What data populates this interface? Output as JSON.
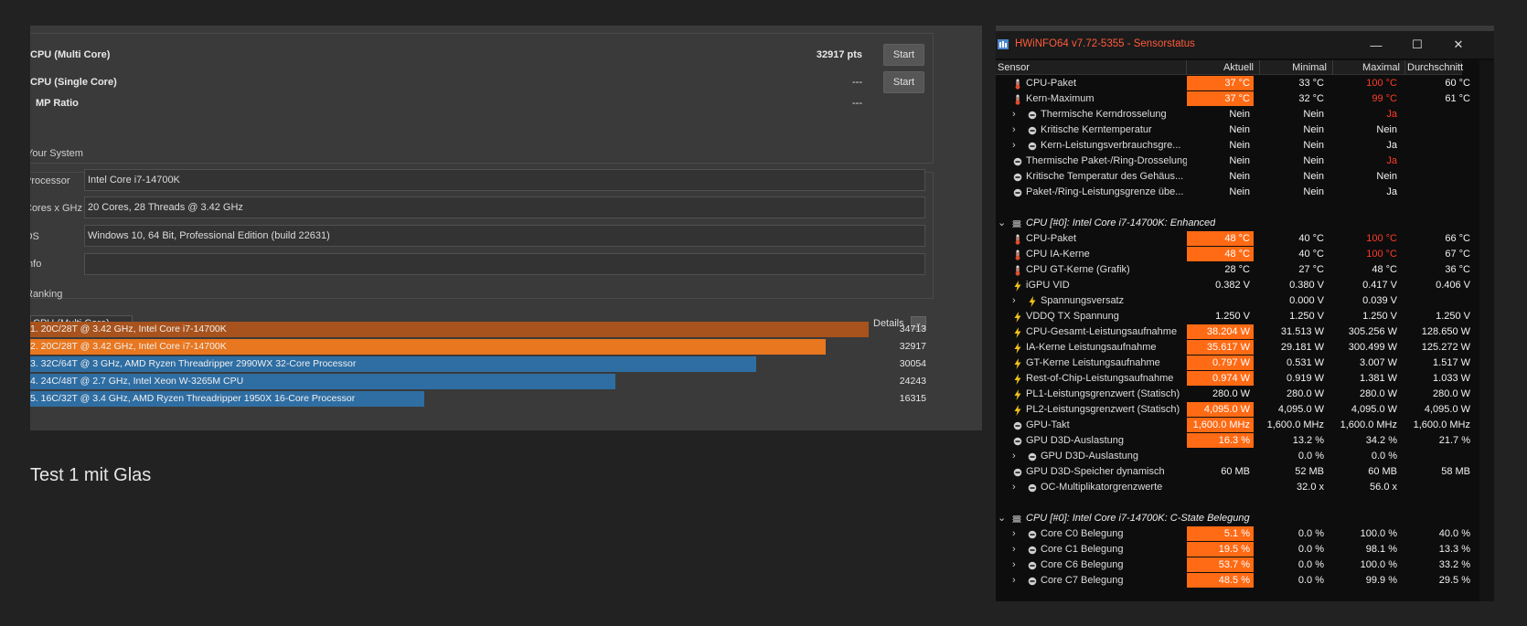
{
  "cinebench": {
    "scores": [
      {
        "name": "CPU (Multi Core)",
        "value": "32917 pts",
        "button": "Start"
      },
      {
        "name": "CPU (Single Core)",
        "value": "---",
        "button": "Start"
      },
      {
        "name": "MP Ratio",
        "value": "---"
      }
    ],
    "your_system": {
      "title": "Your System",
      "rows": [
        {
          "label": "Processor",
          "value": "Intel Core i7-14700K"
        },
        {
          "label": "Cores x GHz",
          "value": "20 Cores, 28 Threads @ 3.42 GHz"
        },
        {
          "label": "OS",
          "value": "Windows 10, 64 Bit, Professional Edition (build 22631)"
        },
        {
          "label": "Info",
          "value": ""
        }
      ]
    },
    "ranking": {
      "title": "Ranking",
      "selector": "CPU (Multi Core)",
      "details_label": "Details",
      "max_score": 34713,
      "entries": [
        {
          "label": "1. 20C/28T @ 3.42 GHz, Intel Core i7-14700K",
          "score": 34713,
          "color": "#a8531d"
        },
        {
          "label": "2. 20C/28T @ 3.42 GHz, Intel Core i7-14700K",
          "score": 32917,
          "color": "#e8771f"
        },
        {
          "label": "3. 32C/64T @ 3 GHz, AMD Ryzen Threadripper 2990WX 32-Core Processor",
          "score": 30054,
          "color": "#2f6ea3"
        },
        {
          "label": "4. 24C/48T @ 2.7 GHz, Intel Xeon W-3265M CPU",
          "score": 24243,
          "color": "#2f6ea3"
        },
        {
          "label": "5. 16C/32T @ 3.4 GHz, AMD Ryzen Threadripper 1950X 16-Core Processor",
          "score": 16315,
          "color": "#2f6ea3"
        }
      ]
    }
  },
  "caption": "Test 1 mit Glas",
  "hwinfo": {
    "title": "HWiNFO64 v7.72-5355 - Sensorstatus",
    "columns": {
      "sensor": "Sensor",
      "current": "Aktuell",
      "min": "Minimal",
      "max": "Maximal",
      "avg": "Durchschnitt"
    },
    "accent_color": "#ff6a14",
    "alert_color": "#ff3b2a",
    "rows": [
      {
        "type": "item",
        "indent": 0,
        "icon": "thermometer-icon",
        "name": "CPU-Paket",
        "cur": "37 °C",
        "min": "33 °C",
        "max": "100 °C",
        "avg": "60 °C",
        "hot": true,
        "max_red": true
      },
      {
        "type": "item",
        "indent": 0,
        "icon": "thermometer-icon",
        "name": "Kern-Maximum",
        "cur": "37 °C",
        "min": "32 °C",
        "max": "99 °C",
        "avg": "61 °C",
        "hot": true,
        "max_red": true
      },
      {
        "type": "item",
        "indent": 1,
        "expandable": true,
        "icon": "status-circle-icon",
        "name": "Thermische Kerndrosselung",
        "cur": "Nein",
        "min": "Nein",
        "max": "Ja",
        "avg": "",
        "max_red": true
      },
      {
        "type": "item",
        "indent": 1,
        "expandable": true,
        "icon": "status-circle-icon",
        "name": "Kritische Kerntemperatur",
        "cur": "Nein",
        "min": "Nein",
        "max": "Nein",
        "avg": ""
      },
      {
        "type": "item",
        "indent": 1,
        "expandable": true,
        "icon": "status-circle-icon",
        "name": "Kern-Leistungsverbrauchsgre...",
        "cur": "Nein",
        "min": "Nein",
        "max": "Ja",
        "avg": ""
      },
      {
        "type": "item",
        "indent": 0,
        "icon": "status-circle-icon",
        "name": "Thermische Paket-/Ring-Drosselung",
        "cur": "Nein",
        "min": "Nein",
        "max": "Ja",
        "avg": "",
        "max_red": true
      },
      {
        "type": "item",
        "indent": 0,
        "icon": "status-circle-icon",
        "name": "Kritische Temperatur des Gehäus...",
        "cur": "Nein",
        "min": "Nein",
        "max": "Nein",
        "avg": ""
      },
      {
        "type": "item",
        "indent": 0,
        "icon": "status-circle-icon",
        "name": "Paket-/Ring-Leistungsgrenze übe...",
        "cur": "Nein",
        "min": "Nein",
        "max": "Ja",
        "avg": ""
      },
      {
        "type": "blank"
      },
      {
        "type": "group",
        "name": "CPU [#0]: Intel Core i7-14700K: Enhanced"
      },
      {
        "type": "item",
        "indent": 0,
        "icon": "thermometer-icon",
        "name": "CPU-Paket",
        "cur": "48 °C",
        "min": "40 °C",
        "max": "100 °C",
        "avg": "66 °C",
        "hot": true,
        "max_red": true
      },
      {
        "type": "item",
        "indent": 0,
        "icon": "thermometer-icon",
        "name": "CPU IA-Kerne",
        "cur": "48 °C",
        "min": "40 °C",
        "max": "100 °C",
        "avg": "67 °C",
        "hot": true,
        "max_red": true
      },
      {
        "type": "item",
        "indent": 0,
        "icon": "thermometer-icon",
        "name": "CPU GT-Kerne (Grafik)",
        "cur": "28 °C",
        "min": "27 °C",
        "max": "48 °C",
        "avg": "36 °C"
      },
      {
        "type": "item",
        "indent": 0,
        "icon": "lightning-icon",
        "name": "iGPU VID",
        "cur": "0.382 V",
        "min": "0.380 V",
        "max": "0.417 V",
        "avg": "0.406 V"
      },
      {
        "type": "item",
        "indent": 1,
        "expandable": true,
        "icon": "lightning-icon",
        "name": "Spannungsversatz",
        "cur": "",
        "min": "0.000 V",
        "max": "0.039 V",
        "avg": ""
      },
      {
        "type": "item",
        "indent": 0,
        "icon": "lightning-icon",
        "name": "VDDQ TX Spannung",
        "cur": "1.250 V",
        "min": "1.250 V",
        "max": "1.250 V",
        "avg": "1.250 V"
      },
      {
        "type": "item",
        "indent": 0,
        "icon": "lightning-icon",
        "name": "CPU-Gesamt-Leistungsaufnahme",
        "cur": "38.204 W",
        "min": "31.513 W",
        "max": "305.256 W",
        "avg": "128.650 W",
        "hot": true
      },
      {
        "type": "item",
        "indent": 0,
        "icon": "lightning-icon",
        "name": "IA-Kerne Leistungsaufnahme",
        "cur": "35.617 W",
        "min": "29.181 W",
        "max": "300.499 W",
        "avg": "125.272 W",
        "hot": true
      },
      {
        "type": "item",
        "indent": 0,
        "icon": "lightning-icon",
        "name": "GT-Kerne Leistungsaufnahme",
        "cur": "0.797 W",
        "min": "0.531 W",
        "max": "3.007 W",
        "avg": "1.517 W",
        "hot": true
      },
      {
        "type": "item",
        "indent": 0,
        "icon": "lightning-icon",
        "name": "Rest-of-Chip-Leistungsaufnahme",
        "cur": "0.974 W",
        "min": "0.919 W",
        "max": "1.381 W",
        "avg": "1.033 W",
        "hot": true
      },
      {
        "type": "item",
        "indent": 0,
        "icon": "lightning-icon",
        "name": "PL1-Leistungsgrenzwert (Statisch)",
        "cur": "280.0 W",
        "min": "280.0 W",
        "max": "280.0 W",
        "avg": "280.0 W"
      },
      {
        "type": "item",
        "indent": 0,
        "icon": "lightning-icon",
        "name": "PL2-Leistungsgrenzwert (Statisch)",
        "cur": "4,095.0 W",
        "min": "4,095.0 W",
        "max": "4,095.0 W",
        "avg": "4,095.0 W",
        "hot": true
      },
      {
        "type": "item",
        "indent": 0,
        "icon": "status-circle-icon",
        "name": "GPU-Takt",
        "cur": "1,600.0 MHz",
        "min": "1,600.0 MHz",
        "max": "1,600.0 MHz",
        "avg": "1,600.0 MHz",
        "hot": true
      },
      {
        "type": "item",
        "indent": 0,
        "icon": "status-circle-icon",
        "name": "GPU D3D-Auslastung",
        "cur": "16.3 %",
        "min": "13.2 %",
        "max": "34.2 %",
        "avg": "21.7 %",
        "hot": true
      },
      {
        "type": "item",
        "indent": 1,
        "expandable": true,
        "icon": "status-circle-icon",
        "name": "GPU D3D-Auslastung",
        "cur": "",
        "min": "0.0 %",
        "max": "0.0 %",
        "avg": ""
      },
      {
        "type": "item",
        "indent": 0,
        "icon": "status-circle-icon",
        "name": "GPU D3D-Speicher dynamisch",
        "cur": "60 MB",
        "min": "52 MB",
        "max": "60 MB",
        "avg": "58 MB"
      },
      {
        "type": "item",
        "indent": 1,
        "expandable": true,
        "icon": "status-circle-icon",
        "name": "OC-Multiplikatorgrenzwerte",
        "cur": "",
        "min": "32.0 x",
        "max": "56.0 x",
        "avg": ""
      },
      {
        "type": "blank"
      },
      {
        "type": "group",
        "name": "CPU [#0]: Intel Core i7-14700K: C-State Belegung"
      },
      {
        "type": "item",
        "indent": 1,
        "expandable": true,
        "icon": "status-circle-icon",
        "name": "Core C0 Belegung",
        "cur": "5.1 %",
        "min": "0.0 %",
        "max": "100.0 %",
        "avg": "40.0 %",
        "hot": true
      },
      {
        "type": "item",
        "indent": 1,
        "expandable": true,
        "icon": "status-circle-icon",
        "name": "Core C1 Belegung",
        "cur": "19.5 %",
        "min": "0.0 %",
        "max": "98.1 %",
        "avg": "13.3 %",
        "hot": true
      },
      {
        "type": "item",
        "indent": 1,
        "expandable": true,
        "icon": "status-circle-icon",
        "name": "Core C6 Belegung",
        "cur": "53.7 %",
        "min": "0.0 %",
        "max": "100.0 %",
        "avg": "33.2 %",
        "hot": true
      },
      {
        "type": "item",
        "indent": 1,
        "expandable": true,
        "icon": "status-circle-icon",
        "name": "Core C7 Belegung",
        "cur": "48.5 %",
        "min": "0.0 %",
        "max": "99.9 %",
        "avg": "29.5 %",
        "hot": true
      }
    ]
  }
}
